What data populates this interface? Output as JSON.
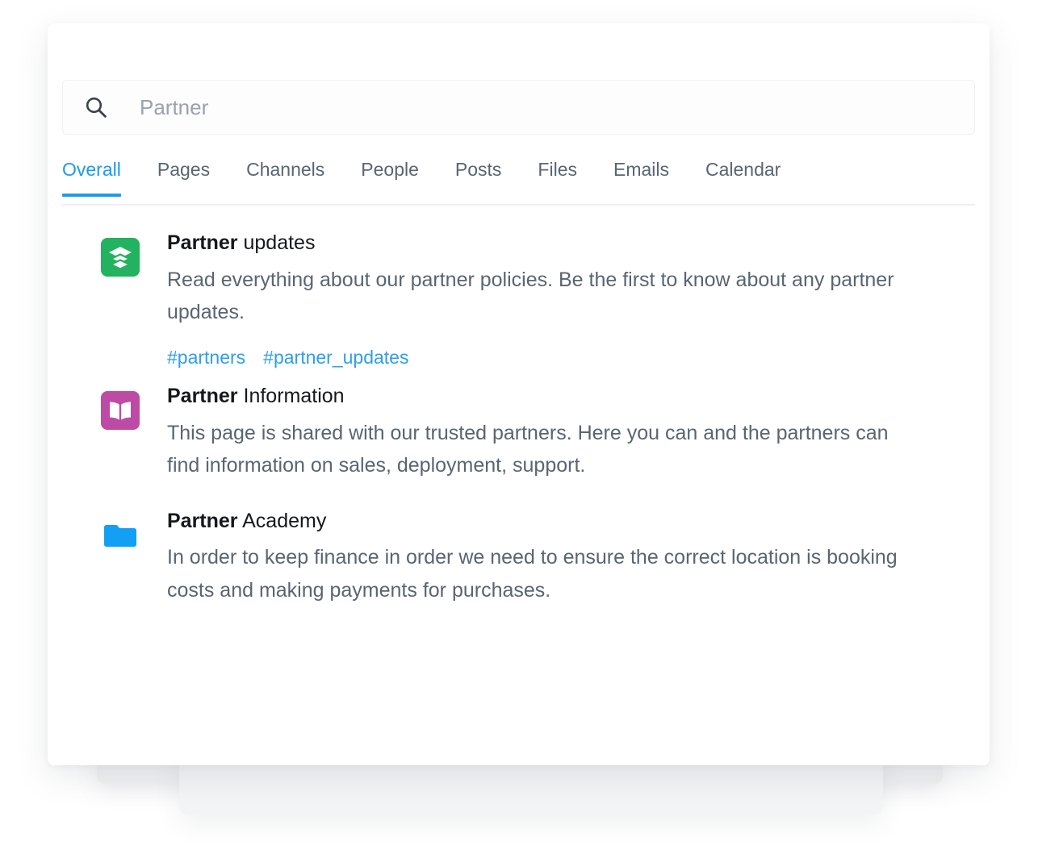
{
  "search": {
    "icon": "search-icon",
    "value": "",
    "placeholder": "Partner"
  },
  "tabs": {
    "active_index": 0,
    "items": [
      {
        "label": "Overall"
      },
      {
        "label": "Pages"
      },
      {
        "label": "Channels"
      },
      {
        "label": "People"
      },
      {
        "label": "Posts"
      },
      {
        "label": "Files"
      },
      {
        "label": "Emails"
      },
      {
        "label": "Calendar"
      }
    ]
  },
  "results": [
    {
      "icon": "layers-stack-icon",
      "icon_color": "#22b260",
      "title_highlight": "Partner",
      "title_rest": " updates",
      "description": "Read everything about our partner policies. Be the first to know about any partner updates.",
      "tags": [
        "#partners",
        "#partner_updates"
      ]
    },
    {
      "icon": "open-book-icon",
      "icon_color": "#bd4ba5",
      "title_highlight": "Partner",
      "title_rest": " Information",
      "description": "This page is shared with our trusted partners. Here you can and the partners can find information on sales, deployment, support.",
      "tags": []
    },
    {
      "icon": "folder-icon",
      "icon_color": "#129ff4",
      "title_highlight": "Partner",
      "title_rest": " Academy",
      "description": "In order to keep finance in order we need to ensure the correct location is booking costs and making payments for purchases.",
      "tags": []
    }
  ],
  "colors": {
    "accent_blue": "#1b9bec",
    "link_blue": "#2f9fe8",
    "text_dark": "#15181c",
    "text_muted": "#5a6572",
    "placeholder": "#9aa2ad"
  }
}
